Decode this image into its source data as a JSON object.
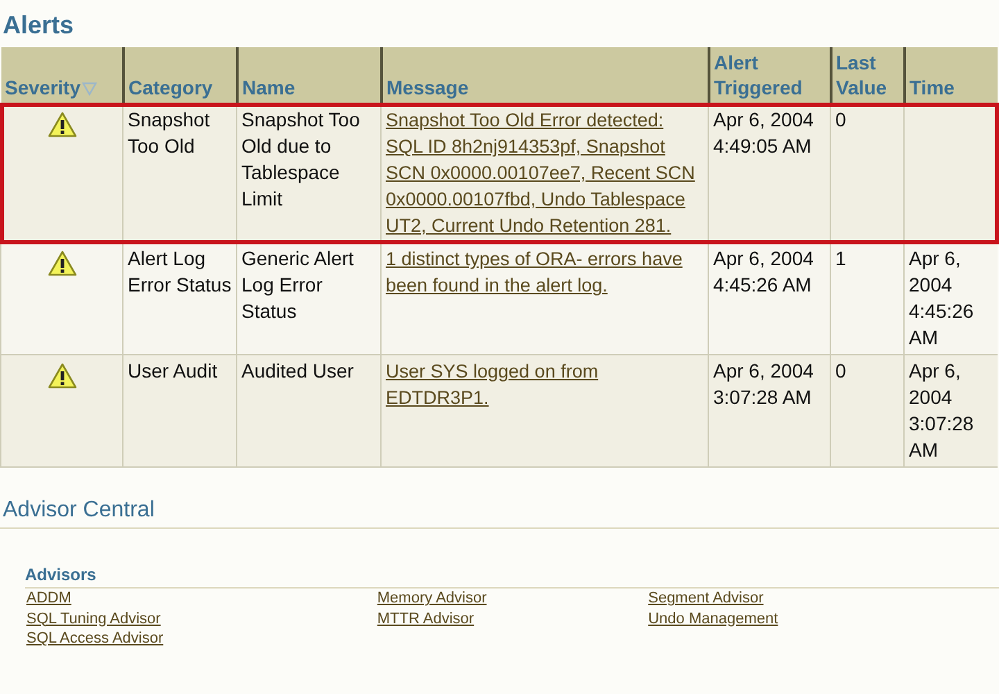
{
  "alerts": {
    "title": "Alerts",
    "columns": [
      {
        "label": "Severity",
        "sorted": true
      },
      {
        "label": "Category",
        "sorted": false
      },
      {
        "label": "Name",
        "sorted": false
      },
      {
        "label": "Message",
        "sorted": false
      },
      {
        "label": "Alert Triggered",
        "sorted": false
      },
      {
        "label": "Last Value",
        "sorted": false
      },
      {
        "label": "Time",
        "sorted": false
      }
    ],
    "rows": [
      {
        "kind": "warning",
        "category": "Snapshot Too Old",
        "name": "Snapshot Too Old due to Tablespace Limit",
        "message": "Snapshot Too Old Error detected: SQL ID 8h2nj914353pf, Snapshot SCN 0x0000.00107ee7, Recent SCN 0x0000.00107fbd, Undo Tablespace UT2, Current Undo Retention 281.",
        "triggered": "Apr 6, 2004 4:49:05 AM",
        "last_value": "0",
        "highlighted": true
      },
      {
        "kind": "warning",
        "category": "Alert Log Error Status",
        "name": "Generic Alert Log Error Status",
        "message": "1 distinct types of ORA- errors have been found in the alert log.",
        "triggered": "Apr 6, 2004 4:45:26 AM",
        "last_value": "1",
        "time": "Apr 6, 2004 4:45:26 AM",
        "highlighted": false
      },
      {
        "kind": "warning",
        "category": "User Audit",
        "name": "Audited User",
        "message": "User SYS logged on from EDTDR3P1.",
        "triggered": "Apr 6, 2004 3:07:28 AM",
        "last_value": "0",
        "time": "Apr 6, 2004 3:07:28 AM",
        "highlighted": false
      }
    ]
  },
  "advisor_central": {
    "title": "Advisor Central",
    "section": "Advisors",
    "columns": [
      [
        "ADDM",
        "SQL Tuning Advisor",
        "SQL Access Advisor"
      ],
      [
        "Memory Advisor",
        "MTTR Advisor"
      ],
      [
        "Segment Advisor",
        "Undo Management"
      ]
    ]
  }
}
